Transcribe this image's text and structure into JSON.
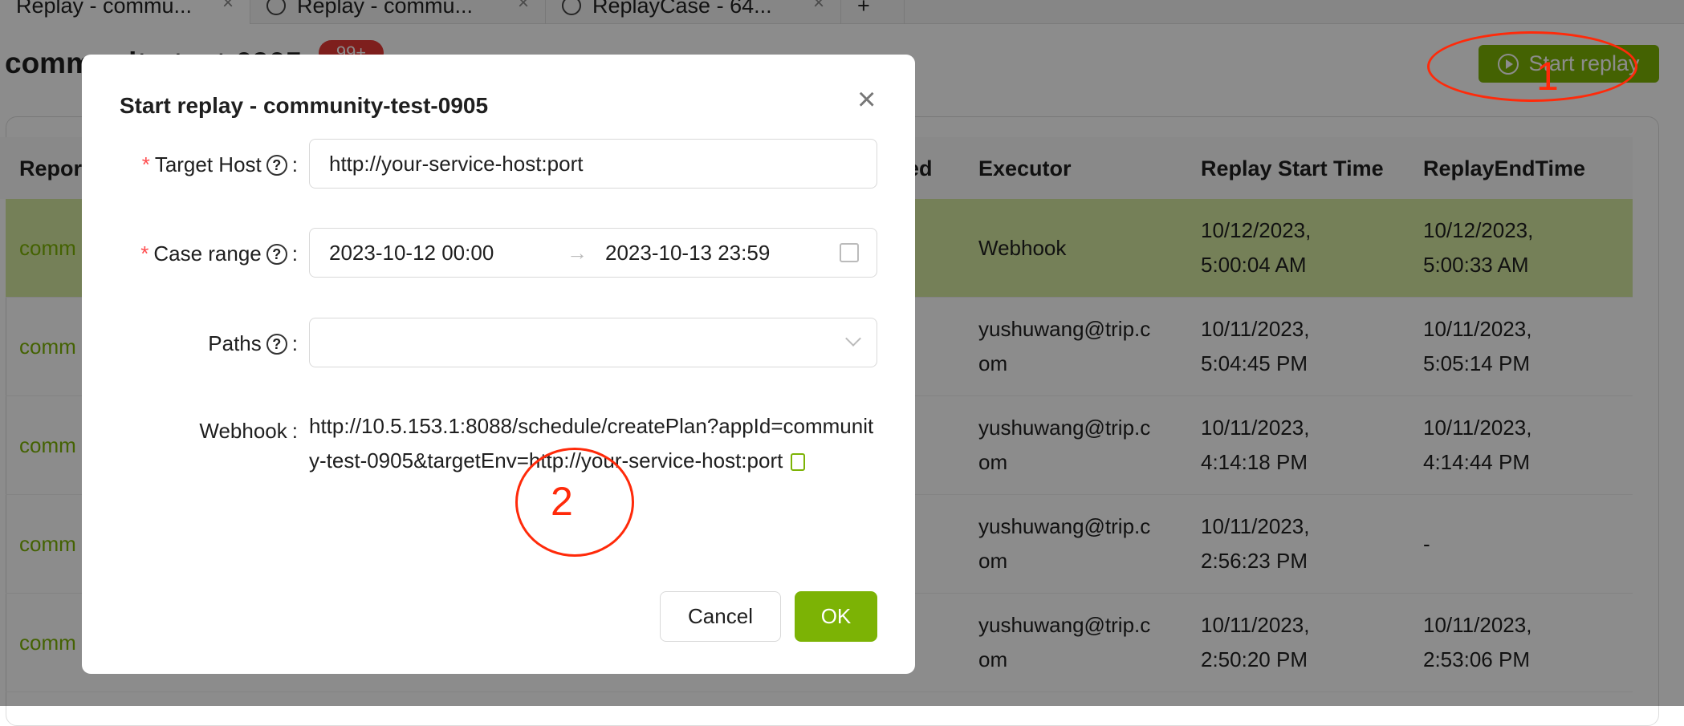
{
  "tabs": [
    {
      "label": "Replay - commu...",
      "active": true
    },
    {
      "label": "Replay - commu...",
      "icon": "clock-icon"
    },
    {
      "label": "ReplayCase - 64...",
      "icon": "clock-icon"
    }
  ],
  "add_tab": "+",
  "page": {
    "title": "community-test-0905",
    "badge": "99+",
    "start_replay": "Start replay"
  },
  "table": {
    "headers": [
      "Repor",
      "ed",
      "Executor",
      "Replay Start Time",
      "ReplayEndTime"
    ],
    "rows": [
      {
        "report": "comm",
        "executor": "Webhook",
        "start": [
          "10/12/2023,",
          "5:00:04 AM"
        ],
        "end": [
          "10/12/2023,",
          "5:00:33 AM"
        ],
        "highlight": true
      },
      {
        "report": "comm",
        "executor": [
          "yushuwang@trip.c",
          "om"
        ],
        "start": [
          "10/11/2023,",
          "5:04:45 PM"
        ],
        "end": [
          "10/11/2023,",
          "5:05:14 PM"
        ]
      },
      {
        "report": "comm",
        "executor": [
          "yushuwang@trip.c",
          "om"
        ],
        "start": [
          "10/11/2023,",
          "4:14:18 PM"
        ],
        "end": [
          "10/11/2023,",
          "4:14:44 PM"
        ]
      },
      {
        "report": "comm",
        "executor": [
          "yushuwang@trip.c",
          "om"
        ],
        "start": [
          "10/11/2023,",
          "2:56:23 PM"
        ],
        "end": [
          "-",
          ""
        ]
      },
      {
        "report": "comm",
        "executor": [
          "yushuwang@trip.c",
          "om"
        ],
        "start": [
          "10/11/2023,",
          "2:50:20 PM"
        ],
        "end": [
          "10/11/2023,",
          "2:53:06 PM"
        ]
      }
    ]
  },
  "modal": {
    "title": "Start replay - community-test-0905",
    "target_host": {
      "label": "Target Host",
      "value": "http://your-service-host:port"
    },
    "case_range": {
      "label": "Case range",
      "start": "2023-10-12 00:00",
      "end": "2023-10-13 23:59"
    },
    "paths": {
      "label": "Paths",
      "value": ""
    },
    "webhook": {
      "label": "Webhook",
      "value": "http://10.5.153.1:8088/schedule/createPlan?appId=community-test-0905&targetEnv=http://your-service-host:port"
    },
    "colon": ":",
    "required": "*",
    "help": "?",
    "cancel": "Cancel",
    "ok": "OK"
  },
  "annotations": [
    "1",
    "2"
  ],
  "colors": {
    "accent": "#7cb305",
    "required": "#ff4d4f",
    "annotation": "#ff2a0a",
    "badge": "#e53935"
  }
}
